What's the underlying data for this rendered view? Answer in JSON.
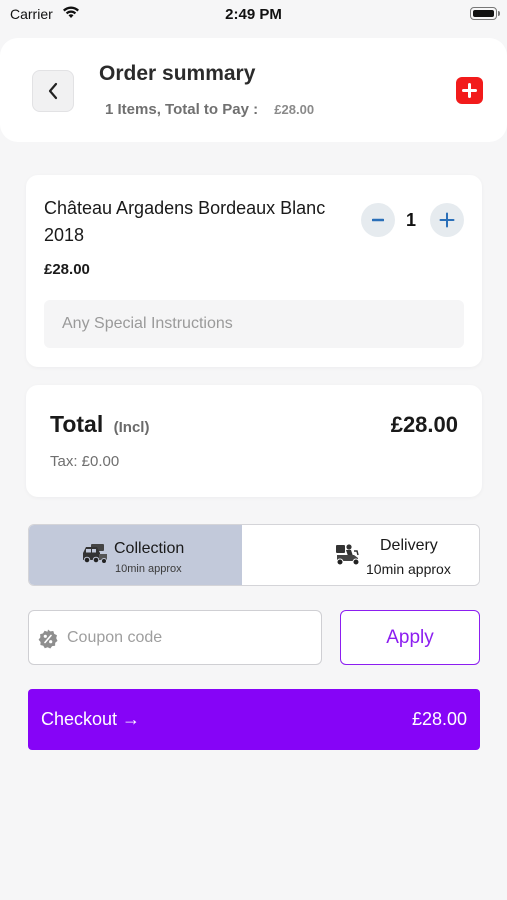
{
  "status_bar": {
    "carrier": "Carrier",
    "time": "2:49 PM"
  },
  "header": {
    "title": "Order summary",
    "subtitle_count": "1",
    "subtitle_text": "Items, Total to Pay :",
    "subtitle_amount": "£28.00"
  },
  "item": {
    "name": "Château Argadens Bordeaux Blanc 2018",
    "price": "£28.00",
    "quantity": "1",
    "instructions_placeholder": "Any Special Instructions"
  },
  "totals": {
    "label": "Total",
    "incl": "(Incl)",
    "amount": "£28.00",
    "tax": "Tax: £0.00"
  },
  "fulfilment": {
    "selected": "collection",
    "collection": {
      "title": "Collection",
      "subtitle": "10min approx"
    },
    "delivery": {
      "title": "Delivery",
      "subtitle": "10min approx"
    }
  },
  "coupon": {
    "placeholder": "Coupon code",
    "value": "",
    "apply_label": "Apply"
  },
  "checkout": {
    "label": "Checkout →",
    "amount": "£28.00"
  },
  "colors": {
    "accent": "#8604f7",
    "add_button": "#f21b1b",
    "selected_mode": "#c2c9da",
    "qty_button": "#e6ebef",
    "qty_icon": "#2a6fb8"
  },
  "icons": {
    "back": "chevron-left-icon",
    "add": "plus-icon",
    "minus": "minus-icon",
    "plus": "plus-icon",
    "collection": "car-icon",
    "delivery": "scooter-icon",
    "coupon": "discount-badge-icon",
    "wifi": "wifi-icon",
    "battery": "battery-icon"
  }
}
